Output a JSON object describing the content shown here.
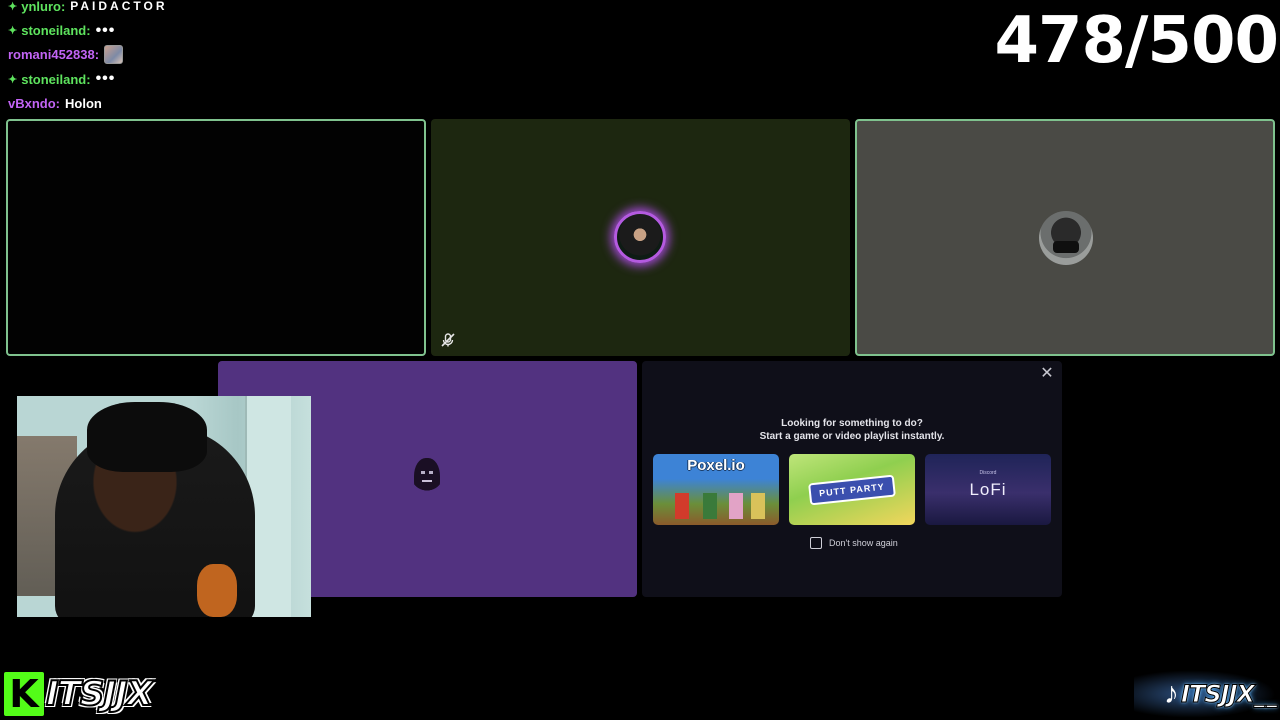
{
  "chat": {
    "lines": [
      {
        "user": "ynluro:",
        "user_color": "#5ee35e",
        "verified": true,
        "message": "PAIDACTOR",
        "message_style": "spaced"
      },
      {
        "user": "stoneiland:",
        "user_color": "#5ee35e",
        "verified": true,
        "message": "•••",
        "message_style": "dots"
      },
      {
        "user": "romani452838:",
        "user_color": "#c264f5",
        "verified": false,
        "message": "",
        "emote": "image-emote"
      },
      {
        "user": "stoneiland:",
        "user_color": "#5ee35e",
        "verified": true,
        "message": "•••",
        "message_style": "dots"
      },
      {
        "user": "vBxndo:",
        "user_color": "#c264f5",
        "verified": false,
        "message": "Holon"
      }
    ]
  },
  "counter": "478/500",
  "activity": {
    "heading_line1": "Looking for something to do?",
    "heading_line2": "Start a game or video playlist instantly.",
    "cards": [
      {
        "title": "Poxel.io"
      },
      {
        "title": "PUTT PARTY"
      },
      {
        "title": "LoFi",
        "sub": "Discord"
      }
    ],
    "dont_show_label": "Don't show again"
  },
  "branding": {
    "kick_letter": "K",
    "kick_name": "ITSJJX",
    "tiktok_name": "ITSJJX__",
    "kick_color": "#53fc18"
  }
}
